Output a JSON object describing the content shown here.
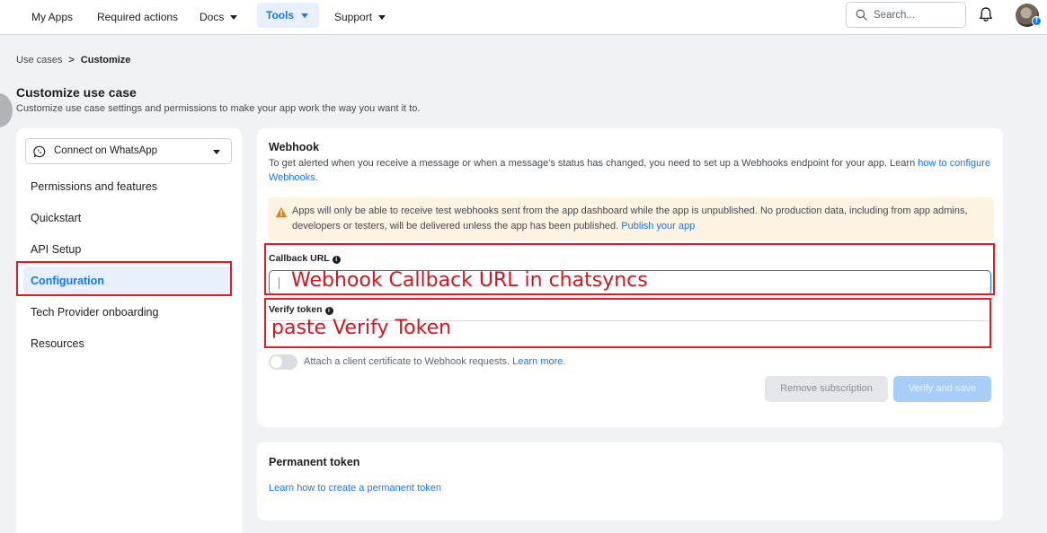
{
  "nav": {
    "items": [
      "My Apps",
      "Required actions",
      "Docs",
      "Tools",
      "Support"
    ],
    "search_placeholder": "Search..."
  },
  "breadcrumb": {
    "parent": "Use cases",
    "separator": ">",
    "current": "Customize"
  },
  "page": {
    "title": "Customize use case",
    "subtitle": "Customize use case settings and permissions to make your app work the way you want it to."
  },
  "sidebar": {
    "selected_use_case": "Connect on WhatsApp",
    "items": [
      "Permissions and features",
      "Quickstart",
      "API Setup",
      "Configuration",
      "Tech Provider onboarding",
      "Resources"
    ],
    "active_item": "Configuration"
  },
  "webhook": {
    "title": "Webhook",
    "description": "To get alerted when you receive a message or when a message's status has changed, you need to set up a Webhooks endpoint for your app. Learn ",
    "description_link": "how to configure Webhooks",
    "description_end": ".",
    "warning": "Apps will only be able to receive test webhooks sent from the app dashboard while the app is unpublished. No production data, including from app admins, developers or testers, will be delivered unless the app has been published. ",
    "warning_link": "Publish your app",
    "callback_label": "Callback URL",
    "verify_label": "Verify token",
    "callback_overlay": "Webhook Callback URL in chatsyncs",
    "verify_overlay": "paste Verify Token",
    "cert_text": "Attach a client certificate to Webhook requests. ",
    "cert_link": "Learn more",
    "cert_end": ".",
    "remove_button": "Remove subscription",
    "verify_button": "Verify and save"
  },
  "permanent_token": {
    "title": "Permanent token",
    "link": "Learn how to create a permanent token"
  },
  "colors": {
    "accent": "#1877f2",
    "annotation": "#e01b24",
    "warning_bg": "#fdf3e2",
    "warning_icon": "#e0821a"
  }
}
